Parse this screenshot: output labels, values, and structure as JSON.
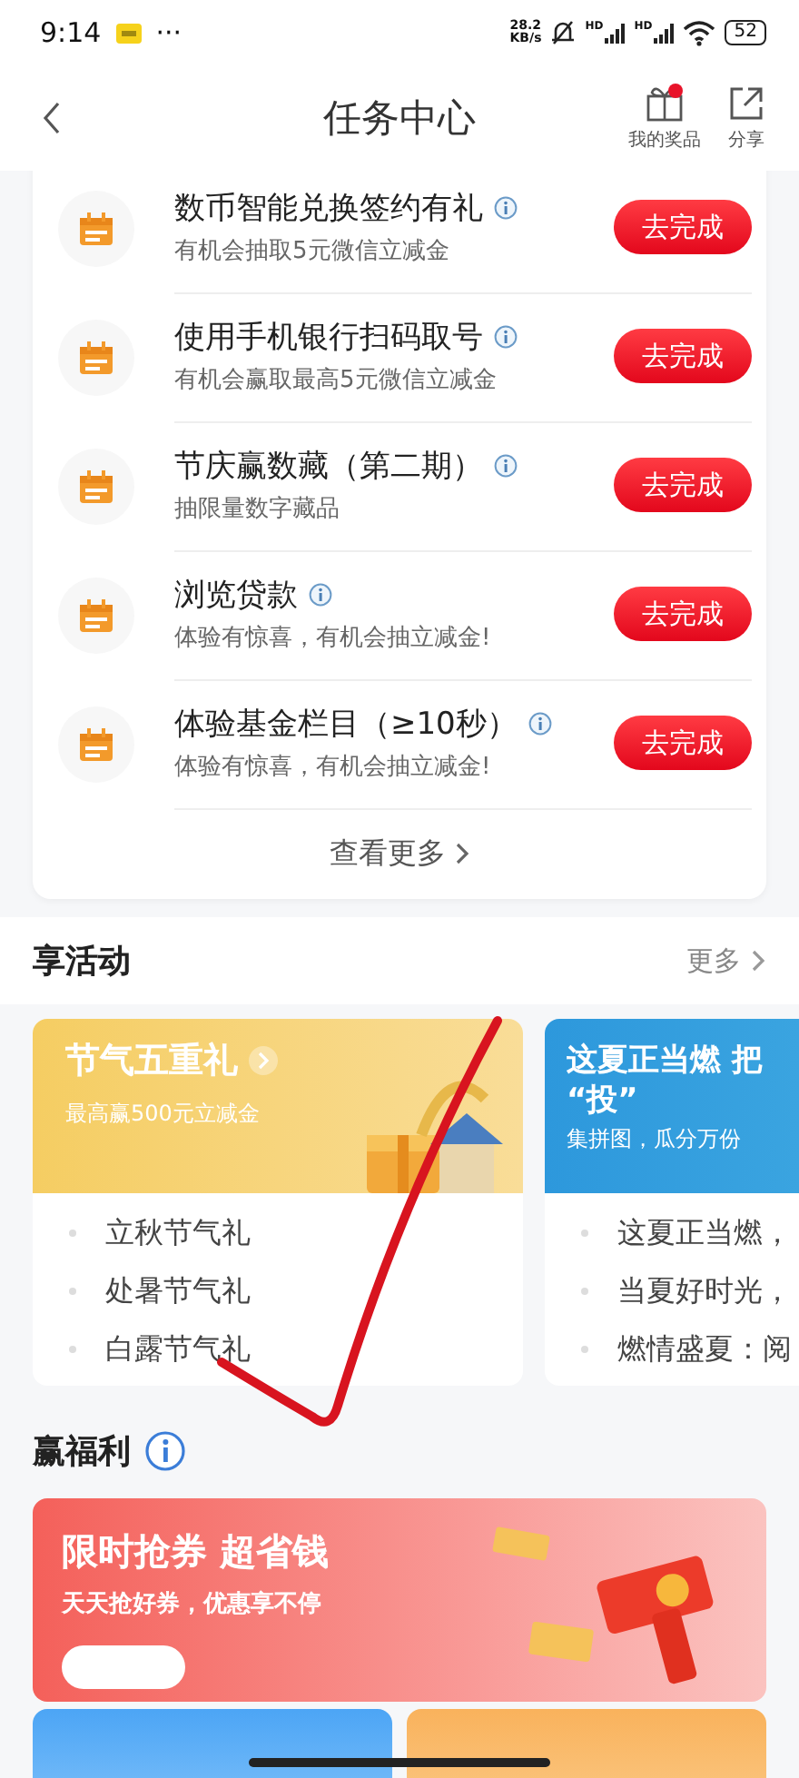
{
  "status_bar": {
    "time": "9:14",
    "more": "···",
    "net_speed": "28.2",
    "net_unit": "KB/s",
    "battery": "52",
    "signals": [
      {
        "label": "HD"
      },
      {
        "label": "HD"
      }
    ]
  },
  "header": {
    "title": "任务中心",
    "actions": [
      {
        "label": "我的奖品",
        "kind": "gift",
        "badge": true
      },
      {
        "label": "分享",
        "kind": "share",
        "badge": false
      }
    ]
  },
  "tasks": {
    "items": [
      {
        "title": "数币智能兑换签约有礼",
        "subtitle": "有机会抽取5元微信立减金",
        "button": "去完成"
      },
      {
        "title": "使用手机银行扫码取号",
        "subtitle": "有机会赢取最高5元微信立减金",
        "button": "去完成"
      },
      {
        "title": "节庆赢数藏（第二期）",
        "subtitle": "抽限量数字藏品",
        "button": "去完成"
      },
      {
        "title": "浏览贷款",
        "subtitle": "体验有惊喜，有机会抽立减金!",
        "button": "去完成"
      },
      {
        "title": "体验基金栏目（≥10秒）",
        "subtitle": "体验有惊喜，有机会抽立减金!",
        "button": "去完成"
      }
    ],
    "more": "查看更多"
  },
  "activities": {
    "title": "享活动",
    "more": "更多",
    "cards": [
      {
        "kind": "solar",
        "title_lines": [
          "节气五重礼"
        ],
        "subtitle": "最高赢500元立减金",
        "items": [
          "立秋节气礼",
          "处暑节气礼",
          "白露节气礼"
        ]
      },
      {
        "kind": "summer",
        "title_lines": [
          "这夏正当燃 把",
          "“投”"
        ],
        "subtitle": "集拼图，瓜分万份",
        "items": [
          "这夏正当燃，",
          "当夏好时光，",
          "燃情盛夏：阅"
        ]
      }
    ]
  },
  "welfare": {
    "title": "赢福利",
    "banner": {
      "title": "限时抢券 超省钱",
      "subtitle": "天天抢好券，优惠享不停"
    },
    "cards": [
      {
        "kind": "blue"
      },
      {
        "kind": "orange"
      }
    ]
  }
}
